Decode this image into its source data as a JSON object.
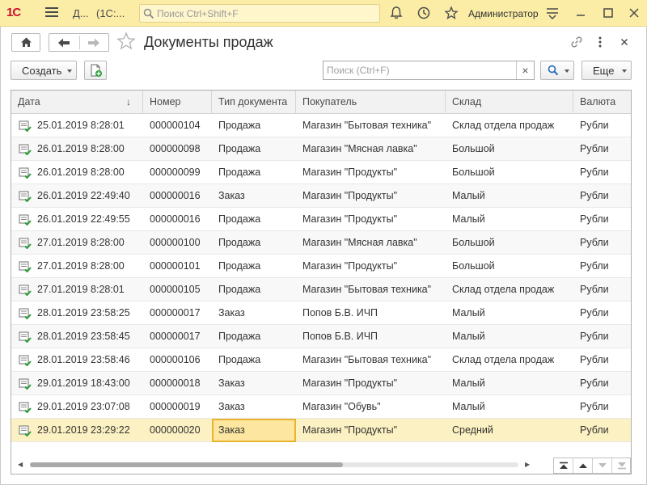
{
  "titlebar": {
    "logo": "1С",
    "title_short": "Д...",
    "title_app": "(1С:...",
    "search_placeholder": "Поиск Ctrl+Shift+F",
    "user": "Администратор"
  },
  "form": {
    "title": "Документы продаж"
  },
  "toolbar": {
    "create_label": "Создать",
    "search_placeholder": "Поиск (Ctrl+F)",
    "clear_label": "×",
    "more_label": "Еще"
  },
  "table": {
    "columns": [
      "Дата",
      "Номер",
      "Тип документа",
      "Покупатель",
      "Склад",
      "Валюта"
    ],
    "sort_indicator": "↓",
    "rows": [
      {
        "date": "25.01.2019 8:28:01",
        "number": "000000104",
        "type": "Продажа",
        "buyer": "Магазин \"Бытовая техника\"",
        "warehouse": "Склад отдела продаж",
        "currency": "Рубли"
      },
      {
        "date": "26.01.2019 8:28:00",
        "number": "000000098",
        "type": "Продажа",
        "buyer": "Магазин \"Мясная лавка\"",
        "warehouse": "Большой",
        "currency": "Рубли"
      },
      {
        "date": "26.01.2019 8:28:00",
        "number": "000000099",
        "type": "Продажа",
        "buyer": "Магазин \"Продукты\"",
        "warehouse": "Большой",
        "currency": "Рубли"
      },
      {
        "date": "26.01.2019 22:49:40",
        "number": "000000016",
        "type": "Заказ",
        "buyer": "Магазин \"Продукты\"",
        "warehouse": "Малый",
        "currency": "Рубли"
      },
      {
        "date": "26.01.2019 22:49:55",
        "number": "000000016",
        "type": "Продажа",
        "buyer": "Магазин \"Продукты\"",
        "warehouse": "Малый",
        "currency": "Рубли"
      },
      {
        "date": "27.01.2019 8:28:00",
        "number": "000000100",
        "type": "Продажа",
        "buyer": "Магазин \"Мясная лавка\"",
        "warehouse": "Большой",
        "currency": "Рубли"
      },
      {
        "date": "27.01.2019 8:28:00",
        "number": "000000101",
        "type": "Продажа",
        "buyer": "Магазин \"Продукты\"",
        "warehouse": "Большой",
        "currency": "Рубли"
      },
      {
        "date": "27.01.2019 8:28:01",
        "number": "000000105",
        "type": "Продажа",
        "buyer": "Магазин \"Бытовая техника\"",
        "warehouse": "Склад отдела продаж",
        "currency": "Рубли"
      },
      {
        "date": "28.01.2019 23:58:25",
        "number": "000000017",
        "type": "Заказ",
        "buyer": "Попов Б.В. ИЧП",
        "warehouse": "Малый",
        "currency": "Рубли"
      },
      {
        "date": "28.01.2019 23:58:45",
        "number": "000000017",
        "type": "Продажа",
        "buyer": "Попов Б.В. ИЧП",
        "warehouse": "Малый",
        "currency": "Рубли"
      },
      {
        "date": "28.01.2019 23:58:46",
        "number": "000000106",
        "type": "Продажа",
        "buyer": "Магазин \"Бытовая техника\"",
        "warehouse": "Склад отдела продаж",
        "currency": "Рубли"
      },
      {
        "date": "29.01.2019 18:43:00",
        "number": "000000018",
        "type": "Заказ",
        "buyer": "Магазин \"Продукты\"",
        "warehouse": "Малый",
        "currency": "Рубли"
      },
      {
        "date": "29.01.2019 23:07:08",
        "number": "000000019",
        "type": "Заказ",
        "buyer": "Магазин \"Обувь\"",
        "warehouse": "Малый",
        "currency": "Рубли"
      },
      {
        "date": "29.01.2019 23:29:22",
        "number": "000000020",
        "type": "Заказ",
        "buyer": "Магазин \"Продукты\"",
        "warehouse": "Средний",
        "currency": "Рубли"
      }
    ]
  },
  "colors": {
    "titlebar_bg": "#fbeda6",
    "selected_row_bg": "#fcf1c2",
    "focus_cell_border": "#e8b52c",
    "doc_icon_green": "#2e9e3b",
    "logo_red": "#c8102e"
  },
  "icons": [
    "menu-icon",
    "search-icon",
    "bell-icon",
    "history-icon",
    "star-icon",
    "settings-icon",
    "minimize-icon",
    "maximize-icon",
    "close-icon",
    "home-icon",
    "back-arrow-icon",
    "forward-arrow-icon",
    "link-icon",
    "more-icon",
    "add-document-icon",
    "posted-document-icon"
  ]
}
